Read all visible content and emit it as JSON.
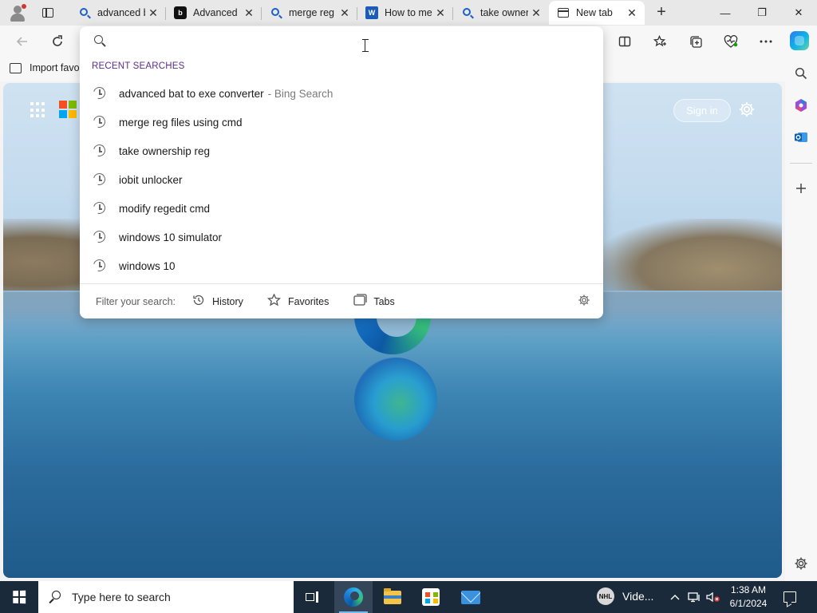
{
  "browser": {
    "tabs": [
      {
        "title": "advanced bat to exe converter - Bing Search",
        "icon": "bing-search-icon"
      },
      {
        "title": "Advanced BAT to EXE Converter",
        "icon": "bat-converter-icon"
      },
      {
        "title": "merge reg files using cmd - Search",
        "icon": "bing-search-icon"
      },
      {
        "title": "How to merge .reg files",
        "icon": "word-icon"
      },
      {
        "title": "take ownership reg - Search",
        "icon": "bing-search-icon"
      },
      {
        "title": "New tab",
        "icon": "new-tab-page-icon",
        "active": true
      }
    ],
    "new_tab_symbol": "+",
    "window_controls": {
      "minimize": "—",
      "restore": "❐",
      "close": "✕"
    }
  },
  "favorites_bar": {
    "import_label": "Import favo"
  },
  "page": {
    "sign_in_label": "Sign in"
  },
  "dropdown": {
    "heading": "RECENT SEARCHES",
    "items": [
      {
        "query": "advanced bat to exe converter",
        "suffix": "- Bing Search"
      },
      {
        "query": "merge reg files using cmd",
        "suffix": ""
      },
      {
        "query": "take ownership reg",
        "suffix": ""
      },
      {
        "query": "iobit unlocker",
        "suffix": ""
      },
      {
        "query": "modify regedit cmd",
        "suffix": ""
      },
      {
        "query": "windows 10 simulator",
        "suffix": ""
      },
      {
        "query": "windows 10",
        "suffix": ""
      }
    ],
    "filter_label": "Filter your search:",
    "filters": [
      "History",
      "Favorites",
      "Tabs"
    ]
  },
  "taskbar": {
    "search_placeholder": "Type here to search",
    "widget_label": "Vide...",
    "time": "1:38 AM",
    "date": "6/1/2024"
  },
  "colors": {
    "accent": "#5b2c8c",
    "taskbar": "#1b2a3a",
    "ms_red": "#f25022",
    "ms_green": "#7fba00",
    "ms_blue": "#00a4ef",
    "ms_yellow": "#ffb900"
  }
}
